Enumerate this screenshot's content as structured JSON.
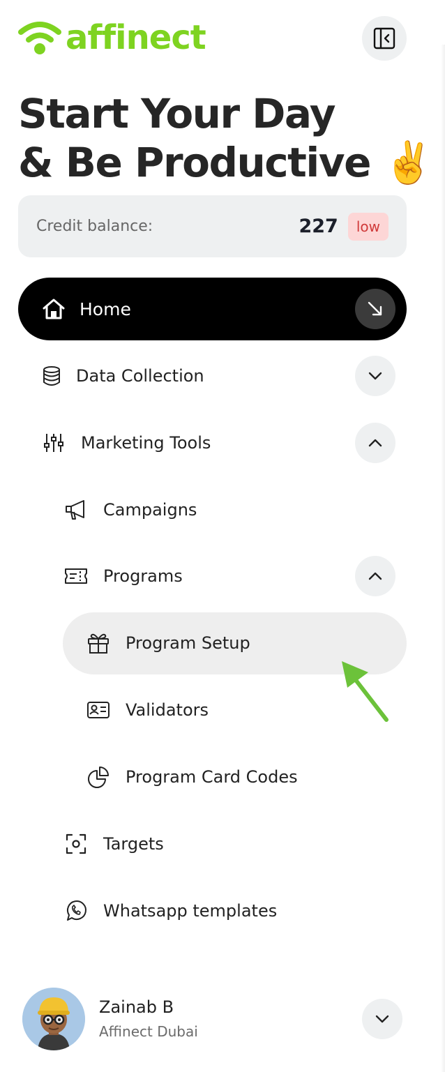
{
  "brand": {
    "name": "affinect",
    "color": "#7ed321"
  },
  "headline": {
    "line1": "Start Your Day",
    "line2": "& Be Productive",
    "emoji": "✌️"
  },
  "credit": {
    "label": "Credit balance:",
    "value": "227",
    "status": "low"
  },
  "nav": {
    "home": {
      "label": "Home",
      "icon": "home-icon",
      "action_icon": "arrow-down-right-icon"
    },
    "data_collection": {
      "label": "Data Collection",
      "icon": "database-icon",
      "expanded": false
    },
    "marketing_tools": {
      "label": "Marketing Tools",
      "icon": "sliders-icon",
      "expanded": true
    },
    "campaigns": {
      "label": "Campaigns",
      "icon": "megaphone-icon"
    },
    "programs": {
      "label": "Programs",
      "icon": "ticket-icon",
      "expanded": true
    },
    "program_setup": {
      "label": "Program Setup",
      "icon": "gift-icon",
      "active": true
    },
    "validators": {
      "label": "Validators",
      "icon": "id-card-icon"
    },
    "program_card_codes": {
      "label": "Program Card Codes",
      "icon": "pie-chart-icon"
    },
    "targets": {
      "label": "Targets",
      "icon": "scan-icon"
    },
    "whatsapp_templates": {
      "label": "Whatsapp templates",
      "icon": "whatsapp-icon"
    }
  },
  "user": {
    "name": "Zainab B",
    "org": "Affinect Dubai"
  },
  "annotation": {
    "arrow_color": "#6cc23a"
  }
}
